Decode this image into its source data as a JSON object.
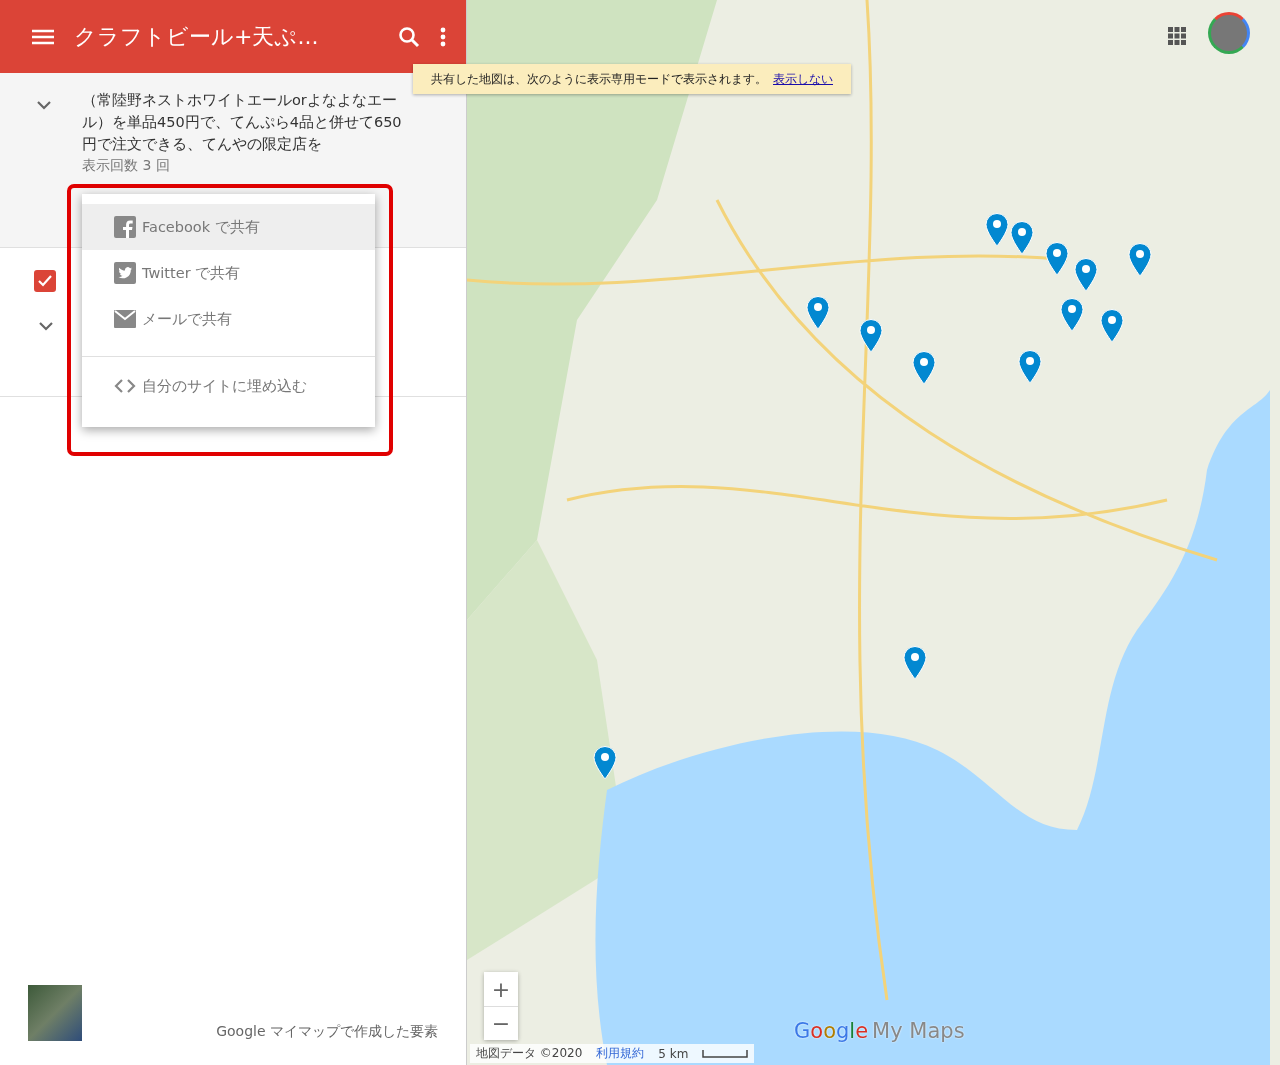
{
  "header": {
    "title": "クラフトビール+天ぷ..."
  },
  "layer_description": {
    "text": "（常陸野ネストホワイトエールorよなよなエール）を単品450円で、てんぷら4品と併せて650円で注文できる、てんやの限定店を",
    "views": "表示回数 3 回"
  },
  "layer": {
    "checked": true
  },
  "share_menu": {
    "items": [
      {
        "kind": "facebook",
        "label": "Facebook で共有",
        "selected": true
      },
      {
        "kind": "twitter",
        "label": "Twitter で共有",
        "selected": false
      },
      {
        "kind": "mail",
        "label": "メールで共有",
        "selected": false
      },
      {
        "kind": "embed",
        "label": "自分のサイトに埋め込む",
        "selected": false
      }
    ]
  },
  "footer": {
    "credit": "Google マイマップで作成した要素"
  },
  "map": {
    "notice": {
      "text": "共有した地図は、次のように表示専用モードで表示されます。",
      "link": "表示しない"
    },
    "zoom_in": "+",
    "zoom_out": "−",
    "logo": {
      "brand": "Google",
      "product": "My Maps"
    },
    "attribution": {
      "data": "地図データ ©2020",
      "terms": "利用規約",
      "scale": "5 km"
    }
  }
}
